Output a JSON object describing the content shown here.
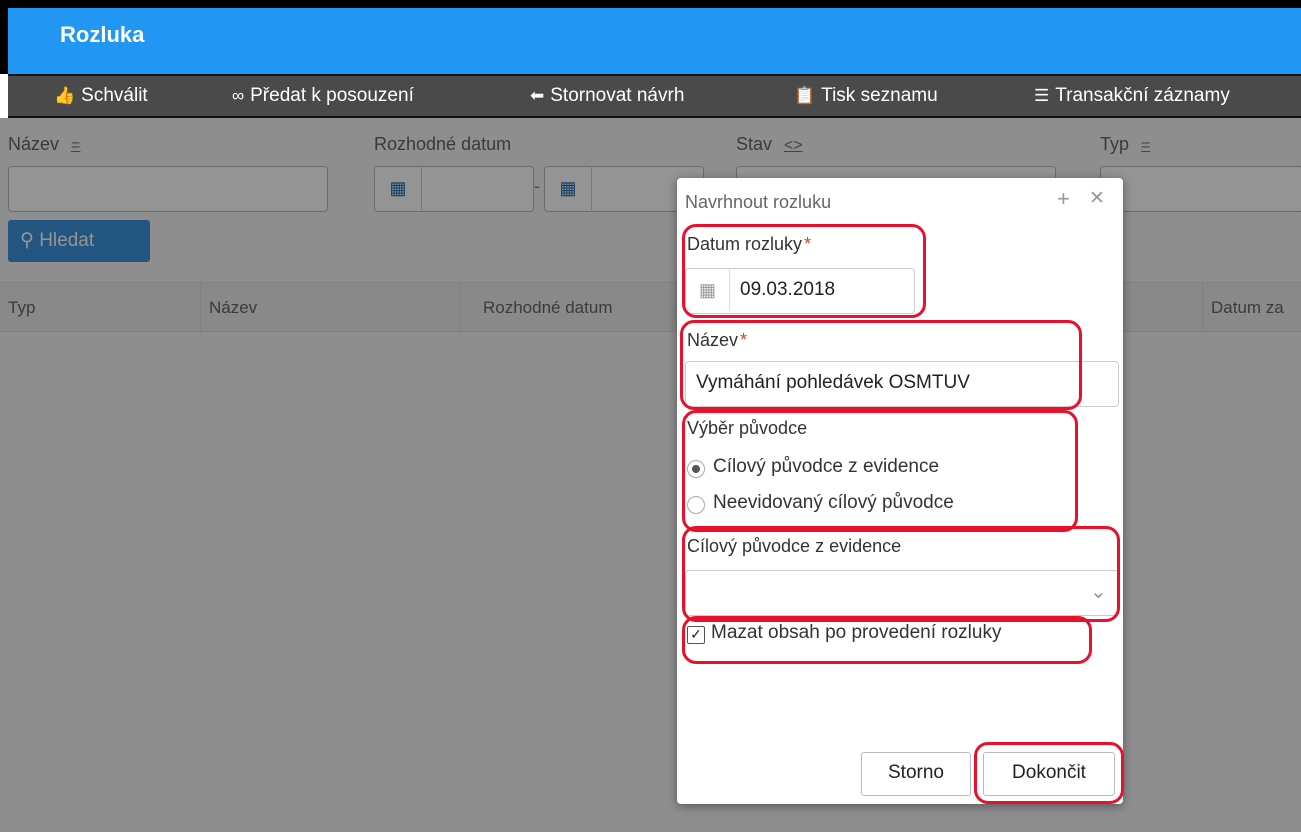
{
  "app": {
    "title": "Rozluka"
  },
  "toolbar": {
    "items": [
      {
        "label": "Schválit",
        "icon": "thumbs-up-icon"
      },
      {
        "label": "Předat k posouzení",
        "icon": "glasses-icon"
      },
      {
        "label": "Stornovat návrh",
        "icon": "reply-icon"
      },
      {
        "label": "Tisk seznamu",
        "icon": "clipboard-icon"
      },
      {
        "label": "Transakční záznamy",
        "icon": "list-icon"
      }
    ]
  },
  "filters": {
    "nazev_label": "Název",
    "rozhodne_datum_label": "Rozhodné datum",
    "stav_label": "Stav",
    "typ_label": "Typ",
    "sort_symbol": "=",
    "stav_symbol": "<>",
    "search_button": "Hledat"
  },
  "grid": {
    "columns": [
      "Typ",
      "Název",
      "Rozhodné datum",
      "Datum za"
    ]
  },
  "dialog": {
    "title": "Navrhnout rozluku",
    "datum_label": "Datum rozluky",
    "datum_value": "09.03.2018",
    "nazev_label": "Název",
    "nazev_value": "Vymáhání pohledávek OSMTUV",
    "vyber_label": "Výběr původce",
    "radio_options": [
      "Cílový původce z evidence",
      "Neevidovaný cílový původce"
    ],
    "selected_radio": 0,
    "cilovy_label": "Cílový původce z evidence",
    "cilovy_value": "",
    "checkbox_label": "Mazat obsah po provedení rozluky",
    "checkbox_checked": true,
    "cancel_button": "Storno",
    "finish_button": "Dokončit"
  },
  "colors": {
    "header_blue": "#2196f3",
    "toolbar_gray": "#4a4a4a",
    "annotation_red": "#e8102a"
  }
}
